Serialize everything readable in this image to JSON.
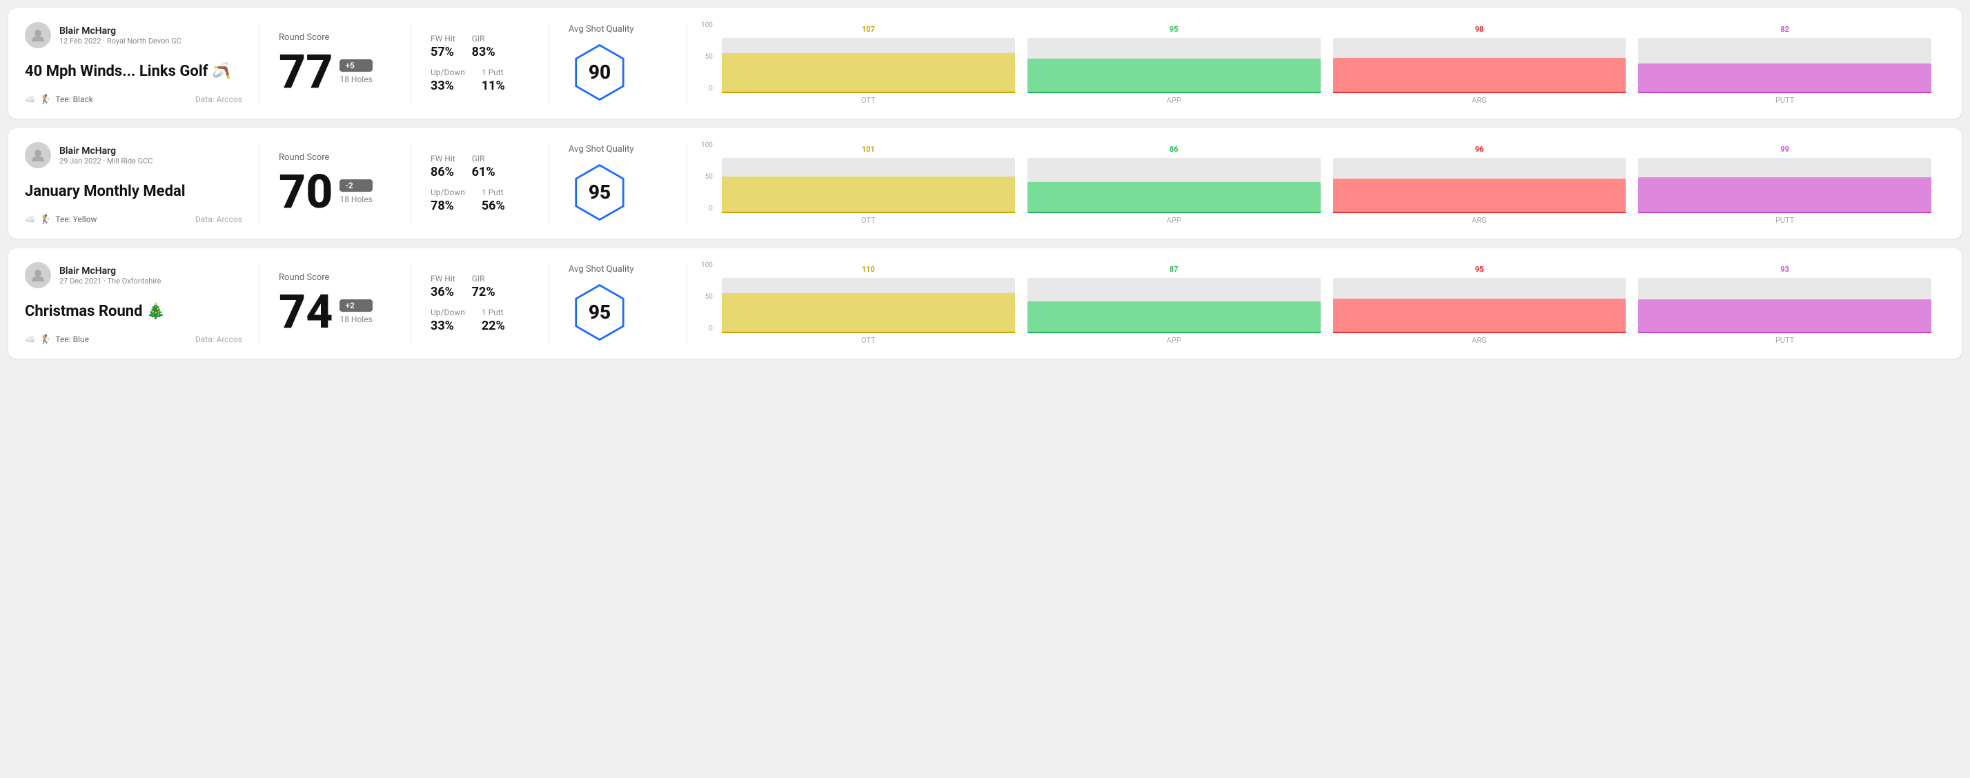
{
  "rounds": [
    {
      "id": "round-1",
      "user": {
        "name": "Blair McHarg",
        "date_course": "12 Feb 2022 · Royal North Devon GC"
      },
      "title": "40 Mph Winds... Links Golf 🪃",
      "tee": "Black",
      "data_source": "Data: Arccos",
      "score": {
        "label": "Round Score",
        "number": "77",
        "badge": "+5",
        "badge_type": "over",
        "holes": "18 Holes"
      },
      "stats": {
        "fw_hit_label": "FW Hit",
        "fw_hit_value": "57%",
        "gir_label": "GIR",
        "gir_value": "83%",
        "updown_label": "Up/Down",
        "updown_value": "33%",
        "oneputt_label": "1 Putt",
        "oneputt_value": "11%"
      },
      "quality": {
        "label": "Avg Shot Quality",
        "score": "90"
      },
      "chart": {
        "bars": [
          {
            "label": "OTT",
            "top_value": "107",
            "height_pct": 72,
            "color_class": "ott-bar",
            "line_class": "ott-line",
            "top_color": "ott-color"
          },
          {
            "label": "APP",
            "top_value": "95",
            "height_pct": 62,
            "color_class": "app-bar",
            "line_class": "app-line",
            "top_color": "app-color"
          },
          {
            "label": "ARG",
            "top_value": "98",
            "height_pct": 64,
            "color_class": "arg-bar",
            "line_class": "arg-line",
            "top_color": "arg-color"
          },
          {
            "label": "PUTT",
            "top_value": "82",
            "height_pct": 54,
            "color_class": "putt-bar",
            "line_class": "putt-line",
            "top_color": "putt-color"
          }
        ],
        "y_labels": [
          "100",
          "50",
          "0"
        ]
      }
    },
    {
      "id": "round-2",
      "user": {
        "name": "Blair McHarg",
        "date_course": "29 Jan 2022 · Mill Ride GCC"
      },
      "title": "January Monthly Medal",
      "tee": "Yellow",
      "data_source": "Data: Arccos",
      "score": {
        "label": "Round Score",
        "number": "70",
        "badge": "-2",
        "badge_type": "under",
        "holes": "18 Holes"
      },
      "stats": {
        "fw_hit_label": "FW Hit",
        "fw_hit_value": "86%",
        "gir_label": "GIR",
        "gir_value": "61%",
        "updown_label": "Up/Down",
        "updown_value": "78%",
        "oneputt_label": "1 Putt",
        "oneputt_value": "56%"
      },
      "quality": {
        "label": "Avg Shot Quality",
        "score": "95"
      },
      "chart": {
        "bars": [
          {
            "label": "OTT",
            "top_value": "101",
            "height_pct": 66,
            "color_class": "ott-bar",
            "line_class": "ott-line",
            "top_color": "ott-color"
          },
          {
            "label": "APP",
            "top_value": "86",
            "height_pct": 56,
            "color_class": "app-bar",
            "line_class": "app-line",
            "top_color": "app-color"
          },
          {
            "label": "ARG",
            "top_value": "96",
            "height_pct": 63,
            "color_class": "arg-bar",
            "line_class": "arg-line",
            "top_color": "arg-color"
          },
          {
            "label": "PUTT",
            "top_value": "99",
            "height_pct": 65,
            "color_class": "putt-bar",
            "line_class": "putt-line",
            "top_color": "putt-color"
          }
        ],
        "y_labels": [
          "100",
          "50",
          "0"
        ]
      }
    },
    {
      "id": "round-3",
      "user": {
        "name": "Blair McHarg",
        "date_course": "27 Dec 2021 · The Oxfordshire"
      },
      "title": "Christmas Round 🎄",
      "tee": "Blue",
      "data_source": "Data: Arccos",
      "score": {
        "label": "Round Score",
        "number": "74",
        "badge": "+2",
        "badge_type": "over",
        "holes": "18 Holes"
      },
      "stats": {
        "fw_hit_label": "FW Hit",
        "fw_hit_value": "36%",
        "gir_label": "GIR",
        "gir_value": "72%",
        "updown_label": "Up/Down",
        "updown_value": "33%",
        "oneputt_label": "1 Putt",
        "oneputt_value": "22%"
      },
      "quality": {
        "label": "Avg Shot Quality",
        "score": "95"
      },
      "chart": {
        "bars": [
          {
            "label": "OTT",
            "top_value": "110",
            "height_pct": 72,
            "color_class": "ott-bar",
            "line_class": "ott-line",
            "top_color": "ott-color"
          },
          {
            "label": "APP",
            "top_value": "87",
            "height_pct": 57,
            "color_class": "app-bar",
            "line_class": "app-line",
            "top_color": "app-color"
          },
          {
            "label": "ARG",
            "top_value": "95",
            "height_pct": 62,
            "color_class": "arg-bar",
            "line_class": "arg-line",
            "top_color": "arg-color"
          },
          {
            "label": "PUTT",
            "top_value": "93",
            "height_pct": 61,
            "color_class": "putt-bar",
            "line_class": "putt-line",
            "top_color": "putt-color"
          }
        ],
        "y_labels": [
          "100",
          "50",
          "0"
        ]
      }
    }
  ]
}
